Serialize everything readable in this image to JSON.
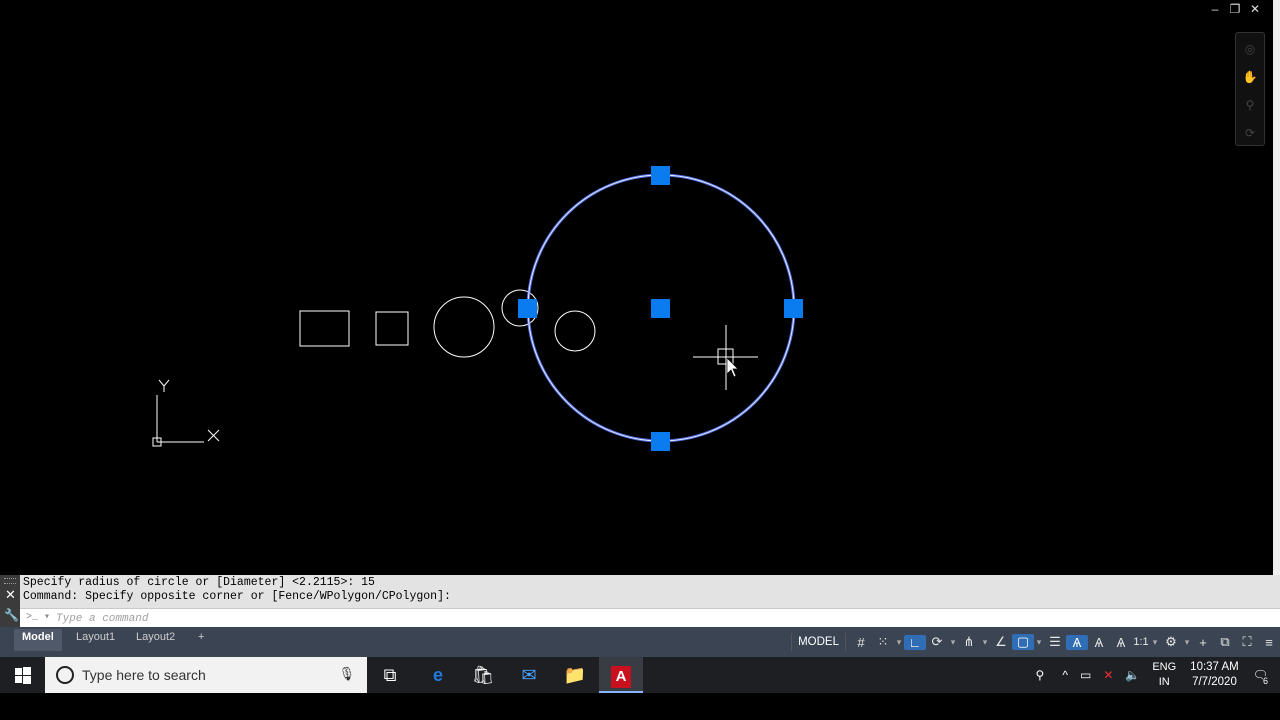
{
  "window_controls": {
    "minimize": "–",
    "restore": "❐",
    "close": "✕"
  },
  "ucs": {
    "x_label": "X",
    "y_label": "Y"
  },
  "command_line": {
    "history": [
      "Specify radius of circle or [Diameter] <2.2115>: 15",
      "Command: Specify opposite corner or [Fence/WPolygon/CPolygon]:"
    ],
    "placeholder": "Type a command"
  },
  "layout_tabs": [
    {
      "label": "Model",
      "active": true
    },
    {
      "label": "Layout1",
      "active": false
    },
    {
      "label": "Layout2",
      "active": false
    },
    {
      "label": "+",
      "active": false
    }
  ],
  "status_bar": {
    "model_label": "MODEL",
    "scale_label": "1:1"
  },
  "taskbar": {
    "search_placeholder": "Type here to search",
    "lang_top": "ENG",
    "lang_bottom": "IN",
    "time": "10:37 AM",
    "date": "7/7/2020",
    "notification_count": "6"
  },
  "colors": {
    "grip_blue": "#0a7cf0",
    "canvas": "#000000",
    "selection_highlight": "#c8d8ff"
  }
}
